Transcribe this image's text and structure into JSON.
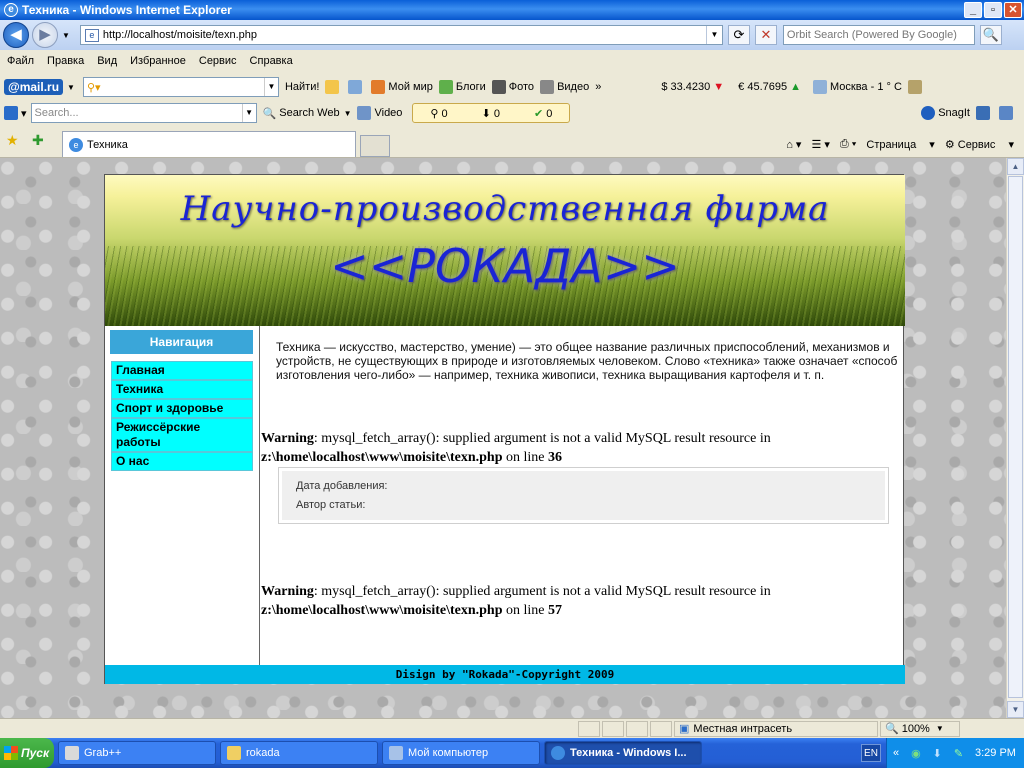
{
  "window": {
    "title": "Техника - Windows Internet Explorer"
  },
  "address": {
    "url": "http://localhost/moisite/texn.php",
    "search_placeholder": "Orbit Search (Powered By Google)"
  },
  "menu": [
    "Файл",
    "Правка",
    "Вид",
    "Избранное",
    "Сервис",
    "Справка"
  ],
  "toolbar1": {
    "brand": "@mail.ru",
    "find_label": "Найти!",
    "items": [
      "Мой мир",
      "Блоги",
      "Фото",
      "Видео"
    ],
    "usd": "$ 33.4230",
    "eur": "€ 45.7695",
    "weather": "Москва  - 1 ° C"
  },
  "toolbar2": {
    "search_placeholder": "Search...",
    "search_web": "Search Web",
    "video": "Video",
    "counters": [
      "0",
      "0",
      "0"
    ],
    "snagit": "SnagIt"
  },
  "tabs": {
    "active": "Техника",
    "page_label": "Страница",
    "tools_label": "Сервис"
  },
  "site": {
    "banner_title": "Научно-производственная фирма",
    "banner_name": "<<РОКАДА>>",
    "nav_title": "Навигация",
    "nav": [
      "Главная",
      "Техника",
      "Спорт и здоровье",
      "Режиссёрские работы",
      "О нас"
    ],
    "intro": "Техника — искусство, мастерство, умение) — это общее название различных приспособлений, механизмов и устройств, не существующих в природе и изготовляемых человеком. Слово «техника» также означает «способ изготовления чего-либо» — например, техника живописи, техника выращивания картофеля и т. п.",
    "warning1": {
      "label": "Warning",
      "msg": ": mysql_fetch_array(): supplied argument is not a valid MySQL result resource in",
      "path": "z:\\home\\localhost\\www\\moisite\\texn.php",
      "online": " on line ",
      "line": "36"
    },
    "warning2": {
      "label": "Warning",
      "msg": ": mysql_fetch_array(): supplied argument is not a valid MySQL result resource in",
      "path": "z:\\home\\localhost\\www\\moisite\\texn.php",
      "online": " on line ",
      "line": "57"
    },
    "date_label": "Дата добавления:",
    "author_label": "Автор статьи:",
    "footer": "Disign by \"Rokada\"-Copyright 2009"
  },
  "status": {
    "zone": "Местная интрасеть",
    "zoom": "100%"
  },
  "taskbar": {
    "start": "Пуск",
    "tasks": [
      "Grab++",
      "rokada",
      "Мой компьютер",
      "Техника - Windows I..."
    ],
    "lang": "EN",
    "time": "3:29 PM"
  }
}
